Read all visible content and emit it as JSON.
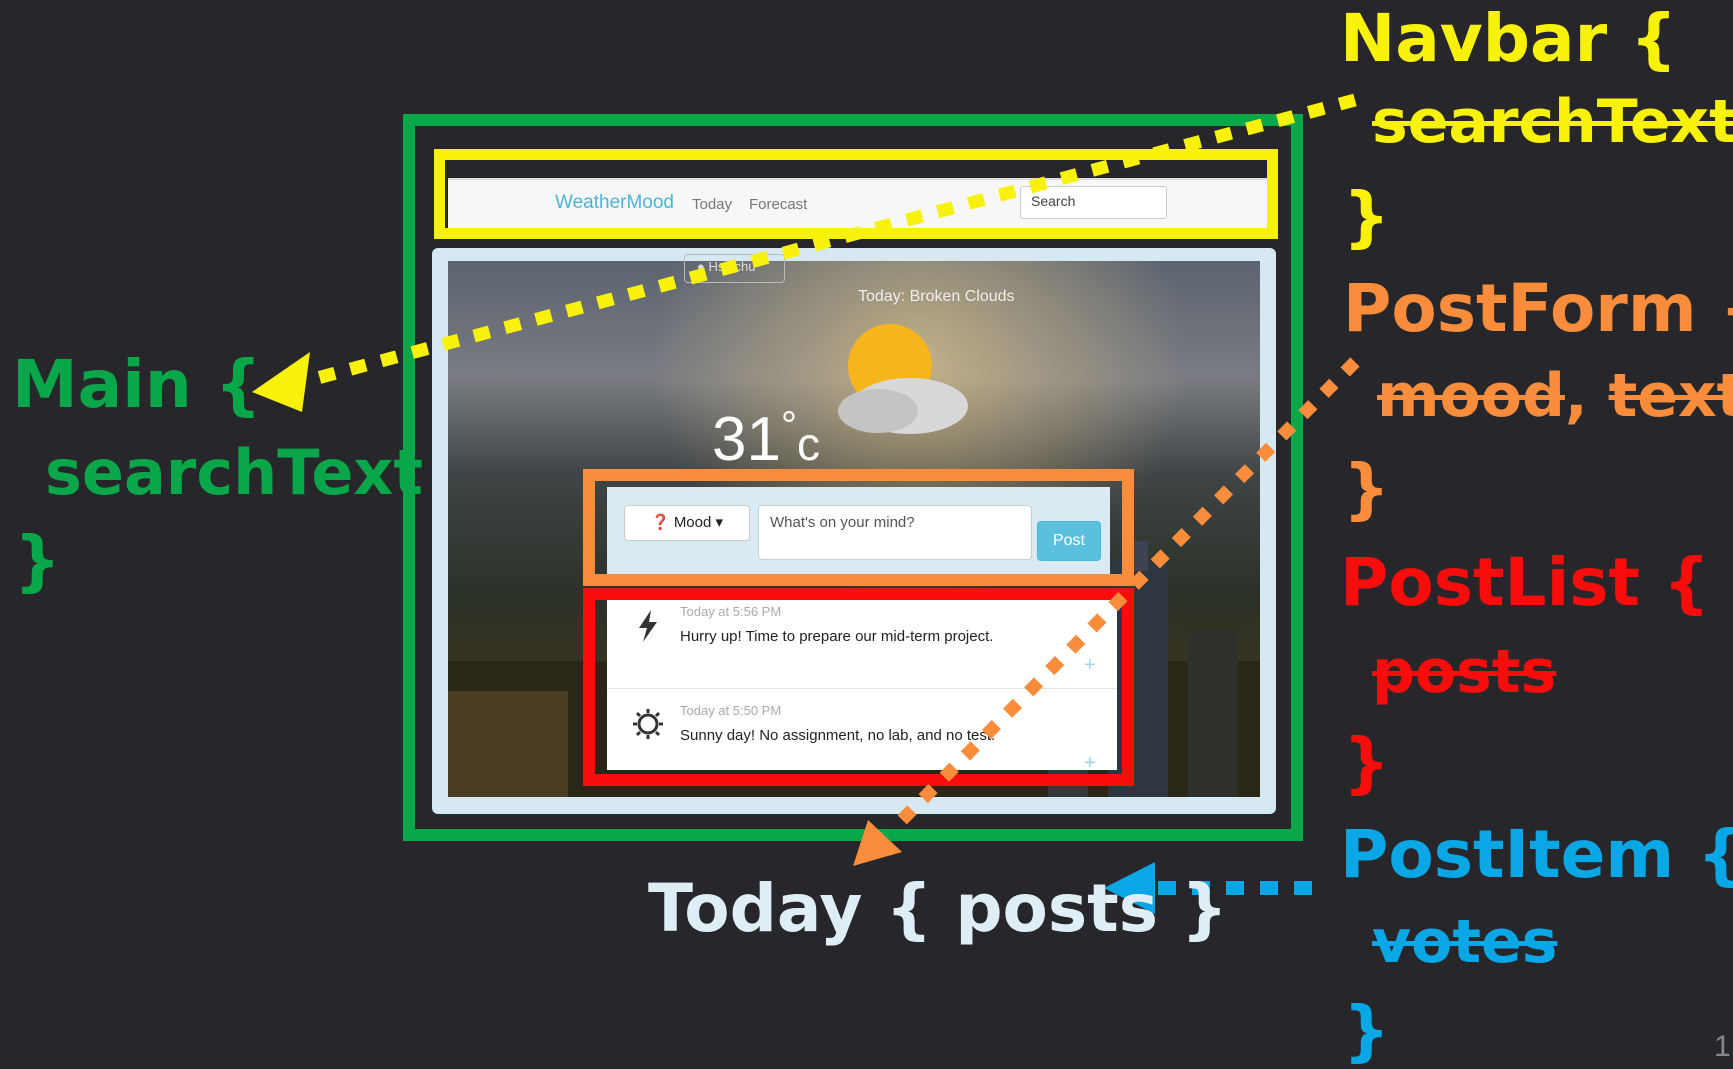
{
  "app": {
    "brand": "WeatherMood",
    "nav_links": [
      "Today",
      "Forecast"
    ],
    "search_value": "Search",
    "location_label": "Hsinchu",
    "weather_description": "Today: Broken Clouds",
    "temperature": "31",
    "temperature_unit": "c",
    "post_form": {
      "mood_label": "Mood",
      "input_placeholder": "What's on your mind?",
      "post_button": "Post"
    },
    "posts": [
      {
        "icon": "lightning-icon",
        "time": "Today at 5:56 PM",
        "text": "Hurry up! Time to prepare our mid-term project."
      },
      {
        "icon": "sun-icon",
        "time": "Today at 5:50 PM",
        "text": "Sunny day! No assignment, no lab, and no test."
      }
    ]
  },
  "annotations": {
    "navbar": {
      "open": "Navbar {",
      "field": "searchText",
      "close": "}",
      "color": "#f8f20a"
    },
    "postform": {
      "open": "PostForm {",
      "field1": "mood",
      "sep": ",",
      "field2": "text",
      "close": "}",
      "color": "#f98d3c"
    },
    "postlist": {
      "open": "PostList {",
      "field": "posts",
      "close": "}",
      "color": "#f80c0c"
    },
    "postitem": {
      "open": "PostItem {",
      "field": "votes",
      "close": "}",
      "color": "#0aa7e6"
    },
    "main": {
      "open": "Main {",
      "field": "searchText",
      "close": "}",
      "color": "#0aa64a"
    },
    "today": {
      "label": "Today { posts }",
      "color": "#dfeef5"
    },
    "page_number": "1"
  }
}
